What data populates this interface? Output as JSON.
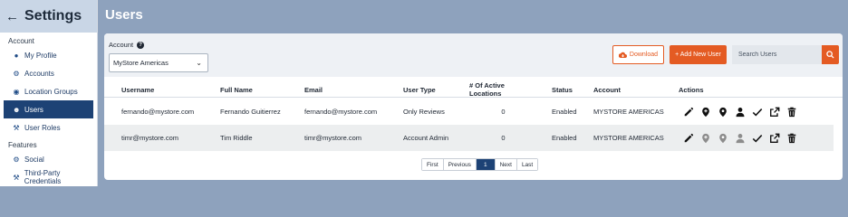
{
  "sidebar": {
    "title": "Settings",
    "sections": [
      {
        "label": "Account"
      },
      {
        "label": "Features"
      }
    ],
    "items": [
      {
        "label": "My Profile",
        "icon": "user-icon"
      },
      {
        "label": "Accounts",
        "icon": "gear-icon"
      },
      {
        "label": "Location Groups",
        "icon": "map-pin-icon"
      },
      {
        "label": "Users",
        "icon": "users-icon",
        "active": true
      },
      {
        "label": "User Roles",
        "icon": "wrench-icon"
      },
      {
        "label": "Social",
        "icon": "gear-icon"
      },
      {
        "label": "Third-Party Credentials",
        "icon": "wrench-icon"
      }
    ]
  },
  "page": {
    "title": "Users"
  },
  "toolbar": {
    "account_label": "Account",
    "account_selected": "MyStore Americas",
    "download_label": "Download",
    "add_user_label": "+ Add New User",
    "search_placeholder": "Search Users"
  },
  "table": {
    "headers": [
      "Username",
      "Full Name",
      "Email",
      "User Type",
      "# Of Active Locations",
      "Status",
      "Account",
      "Actions"
    ],
    "rows": [
      {
        "username": "fernando@mystore.com",
        "full_name": "Fernando Guitierrez",
        "email": "fernando@mystore.com",
        "user_type": "Only Reviews",
        "active_locations": "0",
        "status": "Enabled",
        "account": "MYSTORE AMERICAS",
        "actions_enabled": [
          true,
          true,
          true,
          true,
          true,
          true,
          true
        ]
      },
      {
        "username": "timr@mystore.com",
        "full_name": "Tim Riddle",
        "email": "timr@mystore.com",
        "user_type": "Account Admin",
        "active_locations": "0",
        "status": "Enabled",
        "account": "MYSTORE AMERICAS",
        "actions_enabled": [
          true,
          false,
          false,
          false,
          true,
          true,
          true
        ]
      }
    ]
  },
  "pagination": {
    "first": "First",
    "previous": "Previous",
    "current": "1",
    "next": "Next",
    "last": "Last"
  },
  "colors": {
    "accent": "#e45b23",
    "nav_active": "#1d4275",
    "background": "#8ea2bd"
  }
}
